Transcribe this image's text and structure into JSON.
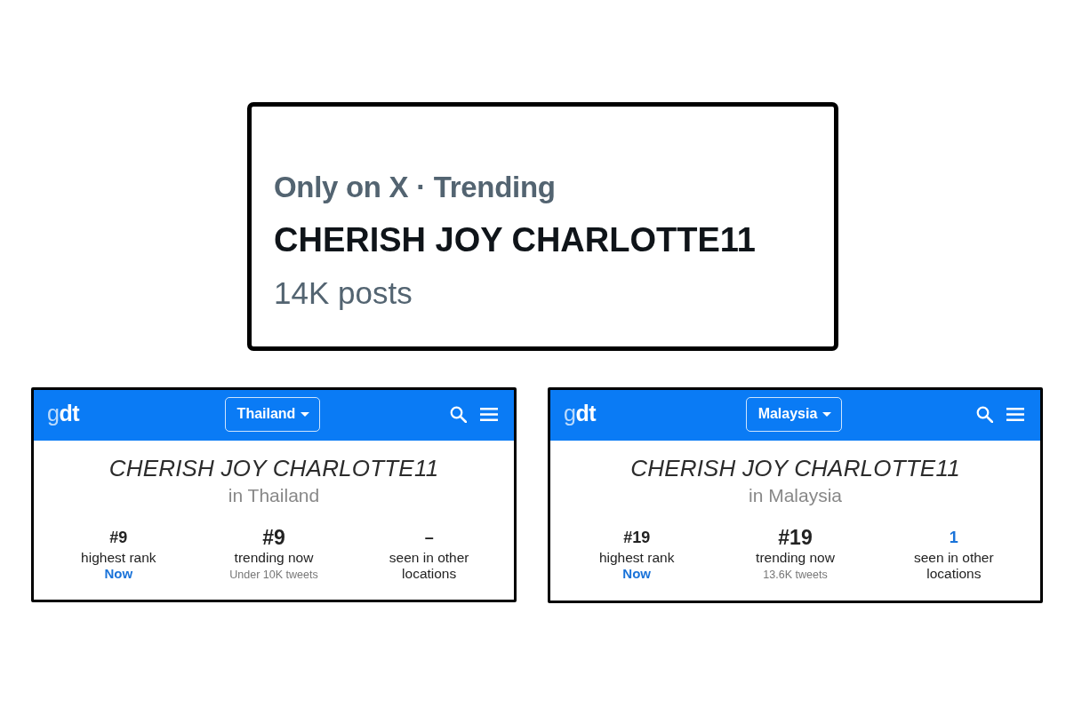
{
  "x_card": {
    "context": "Only on X · Trending",
    "topic": "CHERISH JOY CHARLOTTE11",
    "post_count": "14K posts"
  },
  "trend_cards": [
    {
      "logo": "g**dt**",
      "location_menu": "Thailand",
      "topic": "CHERISH JOY CHARLOTTE11",
      "location_line": "in Thailand",
      "stats": {
        "highest_rank": {
          "value": "#9",
          "label": "highest rank",
          "when": "Now"
        },
        "trending_now": {
          "value": "#9",
          "label": "trending now",
          "note": "Under 10K tweets"
        },
        "other_locations": {
          "value": "–",
          "label": "seen in other locations",
          "linked": false
        }
      }
    },
    {
      "logo": "g**dt**",
      "location_menu": "Malaysia",
      "topic": "CHERISH JOY CHARLOTTE11",
      "location_line": "in Malaysia",
      "stats": {
        "highest_rank": {
          "value": "#19",
          "label": "highest rank",
          "when": "Now"
        },
        "trending_now": {
          "value": "#19",
          "label": "trending now",
          "note": "13.6K tweets"
        },
        "other_locations": {
          "value": "1",
          "label": "seen in other locations",
          "linked": true
        }
      }
    }
  ]
}
